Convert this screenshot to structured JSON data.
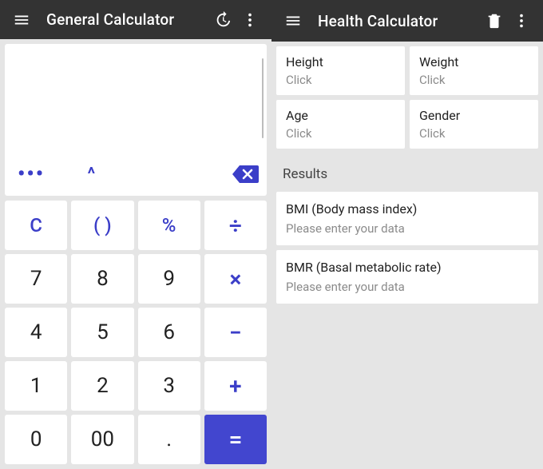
{
  "left": {
    "title": "General Calculator",
    "fn_more": "•••",
    "fn_caret": "^",
    "keys": {
      "clear": "C",
      "paren": "( )",
      "percent": "%",
      "divide": "÷",
      "k7": "7",
      "k8": "8",
      "k9": "9",
      "multiply": "×",
      "k4": "4",
      "k5": "5",
      "k6": "6",
      "minus": "−",
      "k1": "1",
      "k2": "2",
      "k3": "3",
      "plus": "+",
      "k0": "0",
      "k00": "00",
      "dot": ".",
      "equals": "="
    }
  },
  "right": {
    "title": "Health Calculator",
    "fields": {
      "height": {
        "label": "Height",
        "value": "Click"
      },
      "weight": {
        "label": "Weight",
        "value": "Click"
      },
      "age": {
        "label": "Age",
        "value": "Click"
      },
      "gender": {
        "label": "Gender",
        "value": "Click"
      }
    },
    "results_header": "Results",
    "results": {
      "bmi": {
        "title": "BMI (Body mass index)",
        "hint": "Please enter your data"
      },
      "bmr": {
        "title": "BMR (Basal metabolic rate)",
        "hint": "Please enter your data"
      }
    }
  }
}
